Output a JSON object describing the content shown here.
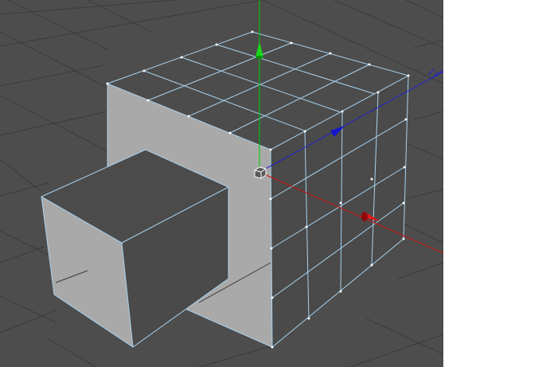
{
  "viewport": {
    "mode": "perspective-3d",
    "selection_mode": "polygons",
    "background_color": "#4d4d4d",
    "grid_color": "#3b3b3b",
    "edge_highlight_color": "#a8d2ef",
    "objects": [
      {
        "name": "large-cube",
        "segments": 4,
        "faces": [
          "top",
          "front-left",
          "front-right"
        ]
      },
      {
        "name": "small-cube",
        "segments": 1,
        "faces": [
          "top",
          "left",
          "right"
        ]
      }
    ],
    "axes": [
      {
        "name": "y-axis",
        "color": "#00cc00"
      },
      {
        "name": "x-axis",
        "color": "#cc1111"
      },
      {
        "name": "z-axis",
        "color": "#2222cc"
      }
    ],
    "face_colors": {
      "top": "#4c4c4c",
      "light": "#a9a9a9",
      "dark": "#4a4a4a"
    }
  },
  "right_pane": {
    "background": "#ffffff"
  }
}
